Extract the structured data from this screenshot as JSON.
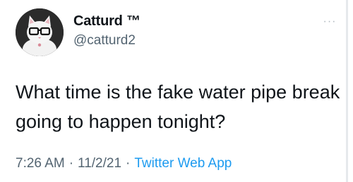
{
  "author": {
    "display_name": "Catturd ™",
    "handle": "@catturd2",
    "avatar_icon": "cat-with-glasses-avatar"
  },
  "more_icon_glyph": "···",
  "tweet": {
    "text": "What time is the fake water pipe break going to happen tonight?"
  },
  "meta": {
    "time": "7:26 AM",
    "separator": "·",
    "date": "11/2/21",
    "source": "Twitter Web App"
  },
  "colors": {
    "text": "#0f1419",
    "muted": "#536471",
    "link": "#1d9bf0",
    "background": "#ffffff"
  }
}
